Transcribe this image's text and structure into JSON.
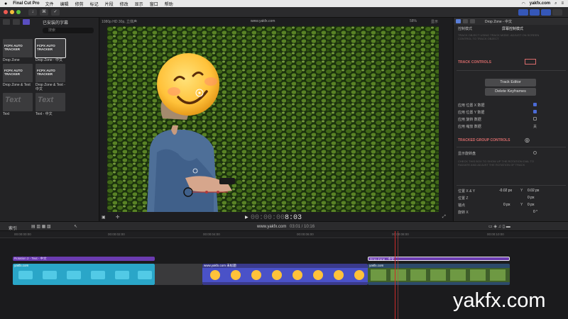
{
  "menubar": {
    "apple": "",
    "app_name": "Final Cut Pro",
    "menus": [
      "文件",
      "编辑",
      "修剪",
      "标记",
      "片段",
      "修改",
      "显示",
      "窗口",
      "帮助"
    ],
    "site": "yakfx.com"
  },
  "toolbar": {
    "key_label": "⌘"
  },
  "browser": {
    "title": "已安装的字幕",
    "search_placeholder": "搜索",
    "tiles": [
      {
        "thumb": "FCPX AUTO TRACKER",
        "label": "Drop Zone"
      },
      {
        "thumb": "FCPX AUTO TRACKER",
        "label": "Drop Zone - 中文"
      },
      {
        "thumb": "FCPX AUTO TRACKER",
        "label": "Drop Zone & Text"
      },
      {
        "thumb": "FCPX AUTO TRACKER",
        "label": "Drop Zone & Text - 中文"
      },
      {
        "thumb": "Text",
        "label": "Text"
      },
      {
        "thumb": "Text",
        "label": "Text - 中文"
      }
    ]
  },
  "viewer": {
    "format": "1080p HD 30p, 立体声",
    "project": "www.yakfx.com",
    "zoom": "58%",
    "show": "显示",
    "timecode_dim": "00:00:00",
    "timecode": "8:03"
  },
  "inspector": {
    "title": "Drop Zone - 中文",
    "control_mode": "控制模式",
    "screen_mode": "屏幕控制模式",
    "hint_1": "TRACK OBJECT USING TRACK MODE. ADJUST ON SCREEN CONTROL TO TRACK OBJECT",
    "track_controls": "TRACK CONTROLS",
    "track_editor": "Track Editor",
    "delete_keyframes": "Delete Keyframes",
    "apply_x": "应用 位置 X 数据",
    "apply_y": "应用 位置 Y 数据",
    "apply_rotation": "应用 旋转 数据",
    "apply_scale": "应用 缩放 数据",
    "scale_value": "关",
    "tracked_group": "TRACKED GROUP CONTROLS",
    "show_rotation": "显示旋转盘",
    "hint_2": "CHECK THIS BOX TO SHOW UP THE ROTATION DIAL TO RADIATE AND ADJUST THE ROTATION OF TRACK",
    "pos_xy": "位置 X & Y",
    "pos_x_val": "-0.02 px",
    "pos_y_label": "Y",
    "pos_y_val": "0.02 px",
    "pos_z": "位置 Z",
    "pos_z_val": "0 px",
    "anchor": "锚点",
    "anchor_x": "0 px",
    "anchor_y_label": "Y",
    "anchor_y": "0 px",
    "rot_x": "旋转 X",
    "rot_x_val": "0 °"
  },
  "timeline": {
    "index": "索引",
    "project": "www.yakfx.com",
    "duration": "03:01 / 10:16",
    "ticks": [
      "00:00:00:00",
      "00:00:02:00",
      "00:00:04:00",
      "00:00:06:00",
      "00:00:08:00",
      "00:00:10:00"
    ],
    "title_clip_1": "Rotation 2 - Text - 中文",
    "title_clip_2": "Drop Zone - 中文",
    "video_clip_1": "yakfx.com",
    "video_clip_2": "www.yakfx.com 未标题",
    "video_clip_3": "yakfx.com"
  },
  "watermark": "yakfx.com",
  "colors": {
    "accent_blue": "#4b6bd6",
    "title_purple": "#6b3bb0",
    "audio_cyan": "#2aa6c8",
    "playhead": "#d02828",
    "track_red": "#d86b6b"
  }
}
